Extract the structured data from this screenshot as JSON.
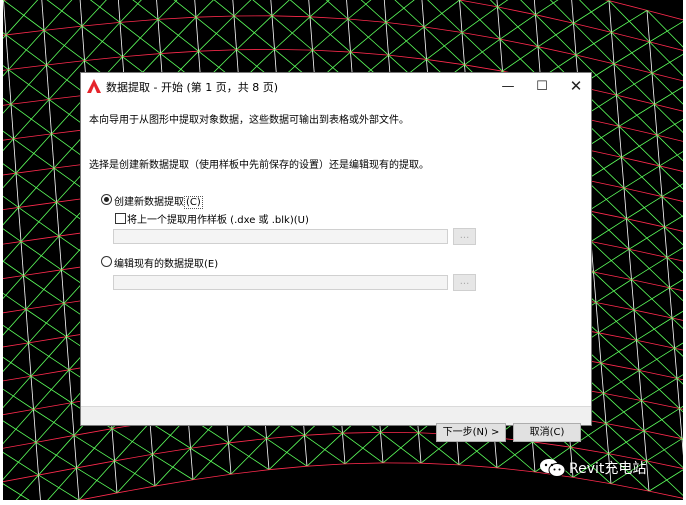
{
  "dialog": {
    "title": "数据提取 - 开始 (第 1 页，共 8 页)",
    "window_controls": {
      "minimize": "—",
      "maximize": "☐",
      "close": "✕"
    },
    "intro_text": "本向导用于从图形中提取对象数据，这些数据可输出到表格或外部文件。",
    "choice_prompt": "选择是创建新数据提取（使用样板中先前保存的设置）还是编辑现有的提取。",
    "options": {
      "create_new": {
        "label": "创建新数据提取",
        "mnemonic": "(C)",
        "selected": true
      },
      "use_template": {
        "label": "将上一个提取用作样板 (.dxe 或 .blk)(U)",
        "checked": false
      },
      "edit_existing": {
        "label": "编辑现有的数据提取(E)",
        "selected": false
      }
    },
    "template_path": {
      "value": ""
    },
    "existing_path": {
      "value": ""
    },
    "browse_label": "...",
    "buttons": {
      "next": "下一步(N) >",
      "cancel": "取消(C)"
    }
  },
  "watermark": {
    "text": "Revit充电站",
    "icon": "wechat-icon"
  },
  "colors": {
    "background": "#000000",
    "mesh_red": "#ff2a4d",
    "mesh_green": "#5cff5c",
    "mesh_white": "#ffffff",
    "autocad_logo": "#e5242b"
  }
}
